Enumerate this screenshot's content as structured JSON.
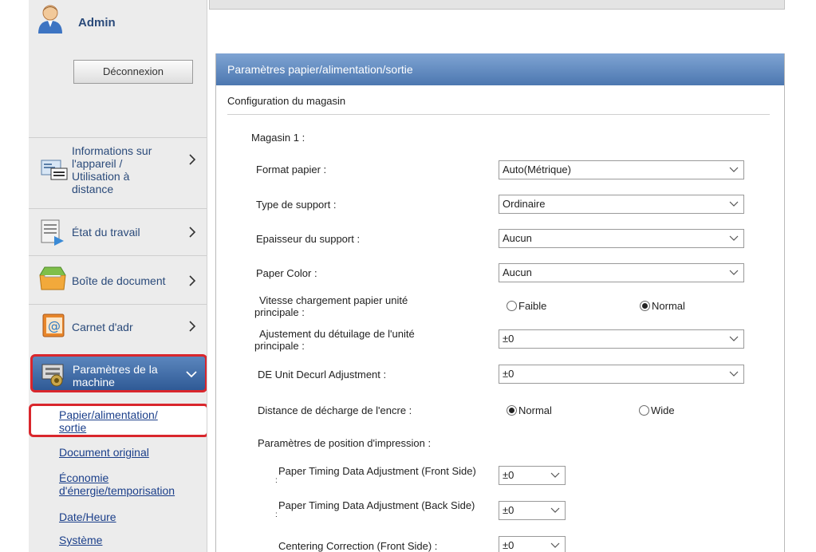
{
  "user": {
    "name": "Admin",
    "logout_label": "Déconnexion"
  },
  "menu": [
    {
      "label_lines": [
        "Informations sur",
        "l'appareil /",
        "Utilisation à",
        "distance"
      ]
    },
    {
      "label_lines": [
        "État du travail"
      ]
    },
    {
      "label_lines": [
        "Boîte de document"
      ]
    },
    {
      "label_lines": [
        "Carnet d'adr"
      ]
    },
    {
      "label_lines": [
        "Paramètres de la",
        "machine"
      ]
    }
  ],
  "submenu": [
    {
      "label_lines": [
        "Papier/alimentation/",
        "sortie"
      ]
    },
    {
      "label_lines": [
        "Document original"
      ]
    },
    {
      "label_lines": [
        "Économie",
        "d'énergie/temporisation"
      ]
    },
    {
      "label_lines": [
        "Date/Heure"
      ]
    },
    {
      "label_lines": [
        "Système"
      ]
    }
  ],
  "panel": {
    "title": "Paramètres papier/alimentation/sortie",
    "section_title": "Configuration du magasin",
    "tray_label": "Magasin 1 :",
    "fields": {
      "format": {
        "label": "Format papier :",
        "value": "Auto(Métrique)"
      },
      "media_type": {
        "label": "Type de support :",
        "value": "Ordinaire"
      },
      "thickness": {
        "label": "Epaisseur du support :",
        "value": "Aucun"
      },
      "color": {
        "label": "Paper Color :",
        "value": "Aucun"
      },
      "feed_speed": {
        "label_lines": [
          "Vitesse chargement papier unité",
          "principale :"
        ],
        "options": [
          "Faible",
          "Normal"
        ],
        "selected": "Normal"
      },
      "decurl_main": {
        "label_lines": [
          "Ajustement du détuilage de l'unité",
          "principale :"
        ],
        "value": "±0"
      },
      "de_decurl": {
        "label": "DE Unit Decurl Adjustment :",
        "value": "±0"
      },
      "ink_distance": {
        "label": "Distance de décharge de l'encre :",
        "options": [
          "Normal",
          "Wide"
        ],
        "selected": "Normal"
      }
    },
    "print_position": {
      "title": "Paramètres de position d'impression :",
      "rows": [
        {
          "label": "Paper Timing Data Adjustment (Front Side)",
          "suffix": ":",
          "value": "±0"
        },
        {
          "label": "Paper Timing Data Adjustment (Back Side)",
          "suffix": ":",
          "value": "±0"
        },
        {
          "label": "Centering Correction (Front Side) :",
          "suffix": "",
          "value": "±0"
        }
      ]
    }
  }
}
